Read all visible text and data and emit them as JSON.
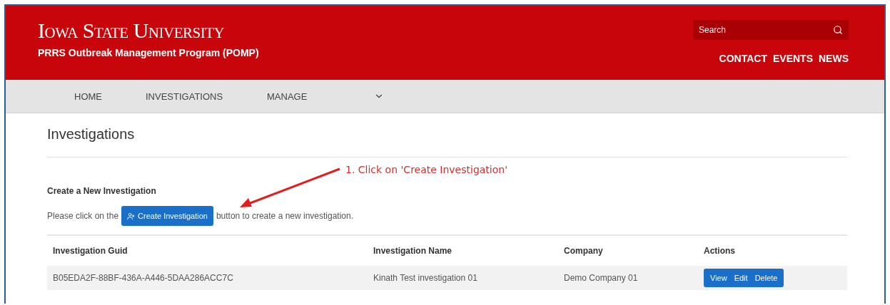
{
  "header": {
    "university": "Iowa State University",
    "program": "PRRS Outbreak Management Program (POMP)",
    "search": {
      "placeholder": "Search"
    },
    "links": [
      "CONTACT",
      "EVENTS",
      "NEWS"
    ]
  },
  "nav": {
    "items": [
      {
        "label": "HOME",
        "kind": "link"
      },
      {
        "label": "INVESTIGATIONS",
        "kind": "link"
      },
      {
        "label": "MANAGE",
        "kind": "link"
      },
      {
        "kind": "dropdown"
      }
    ]
  },
  "page": {
    "title": "Investigations",
    "section_title": "Create a New Investigation",
    "instruction_before": "Please click on the",
    "create_button": "Create Investigation",
    "instruction_after": "button to create a new investigation.",
    "annotation": "1. Click on 'Create Investigation'"
  },
  "table": {
    "columns": [
      "Investigation Guid",
      "Investigation Name",
      "Company",
      "Actions"
    ],
    "rows": [
      {
        "guid": "B05EDA2F-88BF-436A-A446-5DAA286ACC7C",
        "name": "Kinath Test investigation 01",
        "company": "Demo Company 01",
        "actions": [
          "View",
          "Edit",
          "Delete"
        ]
      }
    ]
  }
}
